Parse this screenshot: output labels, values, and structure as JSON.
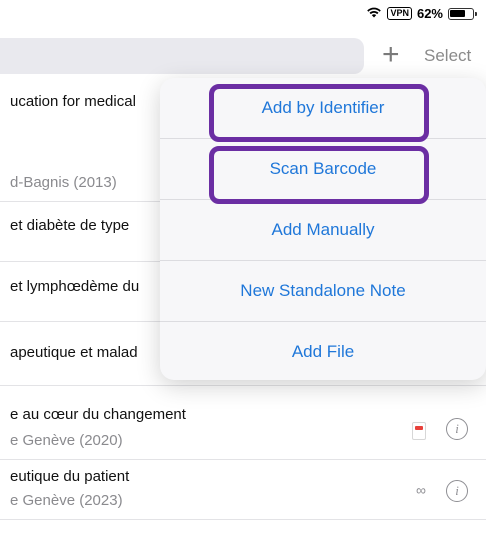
{
  "status_bar": {
    "vpn": "VPN",
    "battery": "62%"
  },
  "header": {
    "add_label": "+",
    "select_label": "Select"
  },
  "rows": [
    {
      "title": "ucation for medical",
      "subtitle": ""
    },
    {
      "title": "",
      "subtitle": "d-Bagnis (2013)"
    },
    {
      "title": "et diabète de type",
      "subtitle": ""
    },
    {
      "title": "et lymphœdème du",
      "subtitle": ""
    },
    {
      "title": "apeutique et malad",
      "subtitle": ""
    },
    {
      "title": "e au cœur du changement",
      "subtitle": "e Genève  (2020)"
    },
    {
      "title": "eutique du patient",
      "subtitle": "e Genève (2023)"
    }
  ],
  "menu": {
    "items": [
      {
        "label": "Add by Identifier"
      },
      {
        "label": "Scan Barcode"
      },
      {
        "label": "Add Manually"
      },
      {
        "label": "New Standalone Note"
      },
      {
        "label": "Add File"
      }
    ]
  },
  "colors": {
    "accent": "#1f77d9",
    "highlight": "#6b2ea3"
  },
  "icons": {
    "wifi": "wifi-icon",
    "battery": "battery-icon",
    "info": "info-icon",
    "pdf": "pdf-icon",
    "link": "link-icon"
  }
}
